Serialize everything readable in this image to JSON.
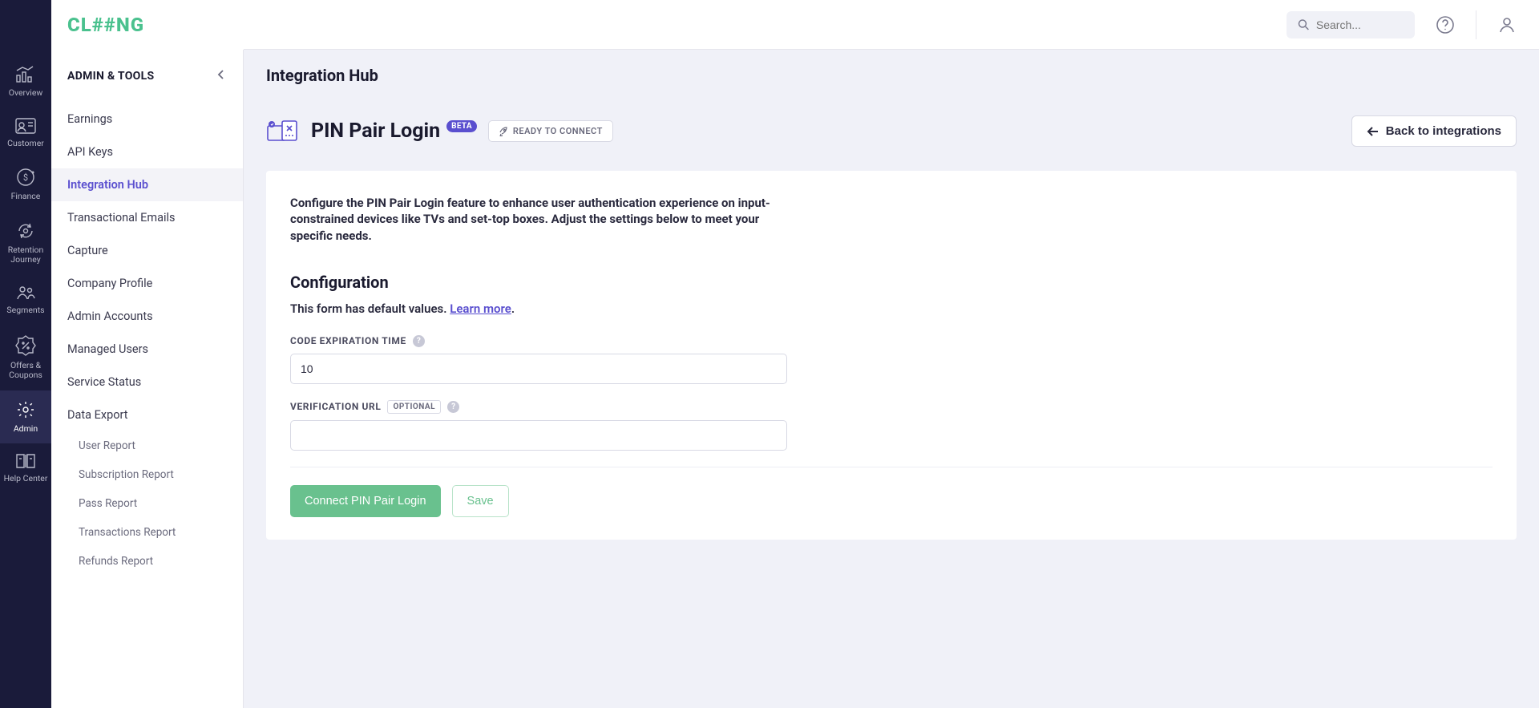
{
  "brand": {
    "name": "CL##NG"
  },
  "header": {
    "search_placeholder": "Search...",
    "help_tooltip": "?",
    "profile": "profile"
  },
  "rail": {
    "items": [
      {
        "id": "overview",
        "label": "Overview"
      },
      {
        "id": "customer",
        "label": "Customer"
      },
      {
        "id": "finance",
        "label": "Finance"
      },
      {
        "id": "retention",
        "label": "Retention Journey"
      },
      {
        "id": "segments",
        "label": "Segments"
      },
      {
        "id": "offers",
        "label": "Offers & Coupons"
      },
      {
        "id": "admin",
        "label": "Admin"
      },
      {
        "id": "help",
        "label": "Help Center"
      }
    ],
    "active_id": "admin"
  },
  "sidebar": {
    "heading": "ADMIN & TOOLS",
    "items": [
      {
        "label": "Earnings"
      },
      {
        "label": "API Keys"
      },
      {
        "label": "Integration Hub",
        "active": true
      },
      {
        "label": "Transactional Emails"
      },
      {
        "label": "Capture"
      },
      {
        "label": "Company Profile"
      },
      {
        "label": "Admin Accounts"
      },
      {
        "label": "Managed Users"
      },
      {
        "label": "Service Status"
      },
      {
        "label": "Data Export"
      }
    ],
    "sub_items": [
      {
        "label": "User Report"
      },
      {
        "label": "Subscription Report"
      },
      {
        "label": "Pass Report"
      },
      {
        "label": "Transactions Report"
      },
      {
        "label": "Refunds Report"
      }
    ]
  },
  "page": {
    "title": "Integration Hub",
    "integration_name": "PIN Pair Login",
    "beta_label": "BETA",
    "status_label": "READY TO CONNECT",
    "back_label": "Back to integrations",
    "intro": "Configure the PIN Pair Login feature to enhance user authentication experience on input-constrained devices like TVs and set-top boxes. Adjust the settings below to meet your specific needs.",
    "config_heading": "Configuration",
    "default_values_prefix": "This form has default values. ",
    "learn_more": "Learn more",
    "period": ".",
    "fields": {
      "code_expiration": {
        "label": "CODE EXPIRATION TIME",
        "value": "10"
      },
      "verification_url": {
        "label": "VERIFICATION URL",
        "optional_label": "OPTIONAL",
        "value": ""
      }
    },
    "buttons": {
      "connect": "Connect PIN Pair Login",
      "save": "Save"
    }
  },
  "colors": {
    "accent_purple": "#5a4fcf",
    "accent_green": "#69c18e",
    "rail_bg": "#1a1b3a"
  }
}
